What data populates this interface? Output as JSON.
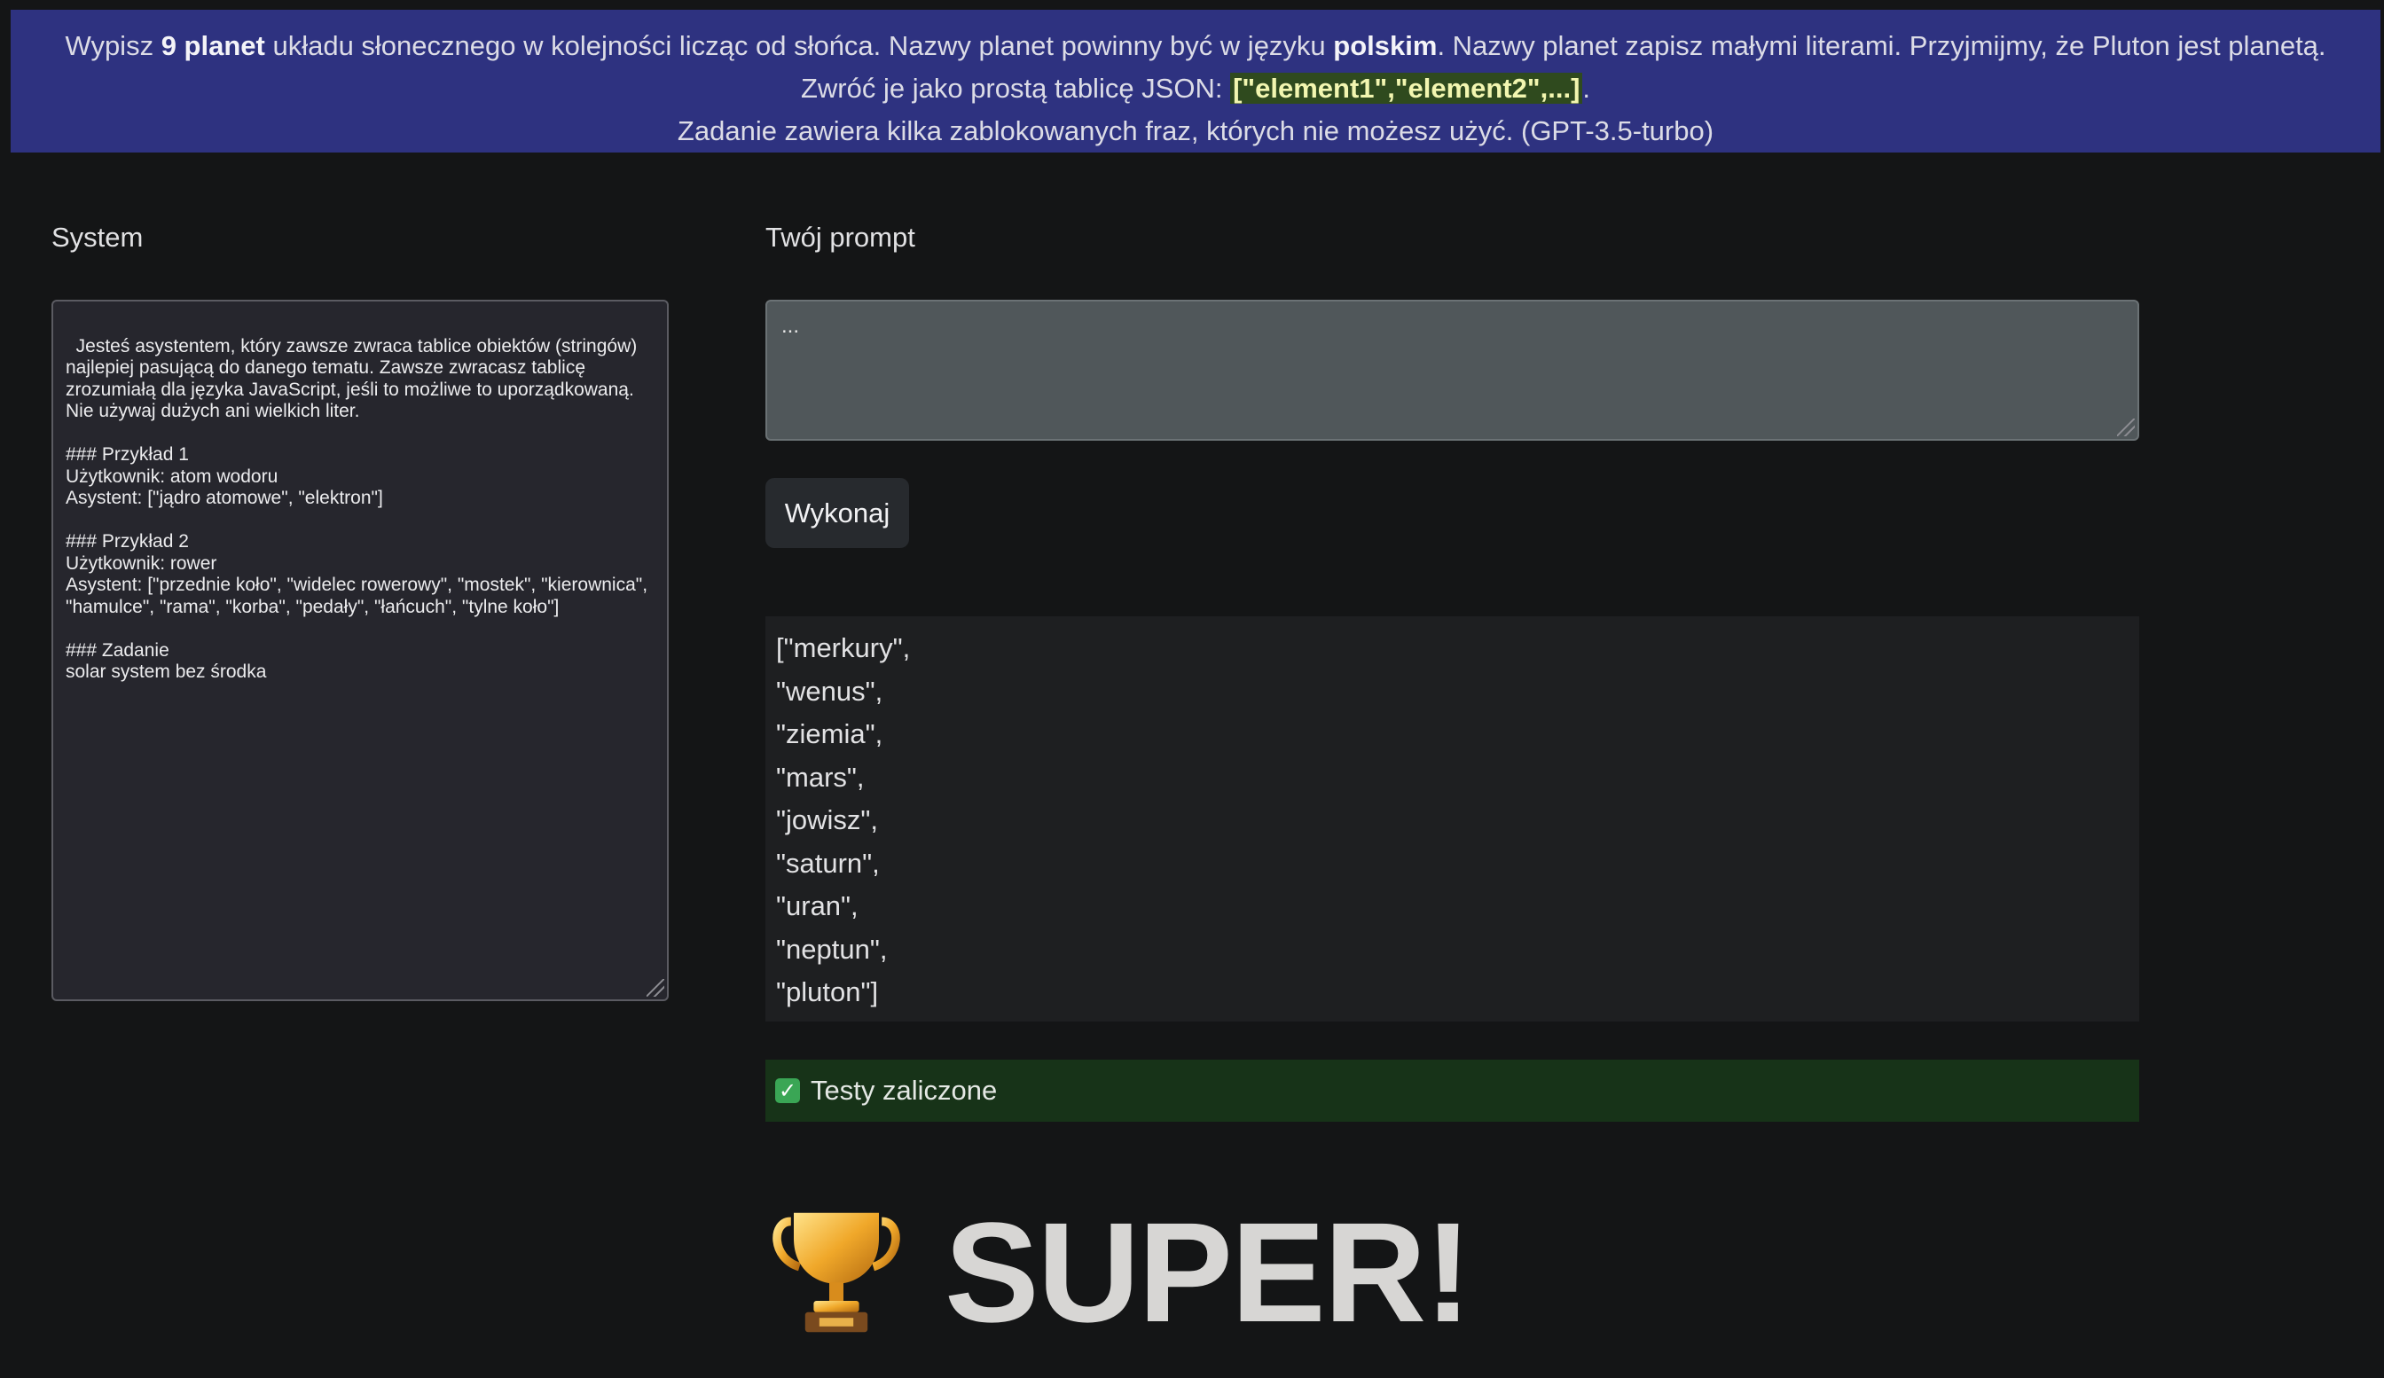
{
  "banner": {
    "line1_pre": "Wypisz ",
    "line1_bold1": "9 planet",
    "line1_mid": " układu słonecznego w kolejności licząc od słońca. Nazwy planet powinny być w języku ",
    "line1_bold2": "polskim",
    "line1_post": ". Nazwy planet zapisz małymi literami. Przyjmijmy, że Pluton jest planetą.",
    "line2_pre": "Zwróć je jako prostą tablicę JSON: ",
    "line2_code": "[\"element1\",\"element2\",...]",
    "line2_post": ".",
    "line3": "Zadanie zawiera kilka zablokowanych fraz, których nie możesz użyć. (GPT-3.5-turbo)"
  },
  "system": {
    "label": "System",
    "text": "Jesteś asystentem, który zawsze zwraca tablice obiektów (stringów)\nnajlepiej pasującą do danego tematu. Zawsze zwracasz tablicę\nzrozumiałą dla języka JavaScript, jeśli to możliwe to uporządkowaną.\nNie używaj dużych ani wielkich liter.\n\n### Przykład 1\nUżytkownik: atom wodoru\nAsystent: [\"jądro atomowe\", \"elektron\"]\n\n### Przykład 2\nUżytkownik: rower\nAsystent: [\"przednie koło\", \"widelec rowerowy\", \"mostek\", \"kierownica\",\n\"hamulce\", \"rama\", \"korba\", \"pedały\", \"łańcuch\", \"tylne koło\"]\n\n### Zadanie\nsolar system bez środka"
  },
  "prompt": {
    "label": "Twój prompt",
    "value": "..."
  },
  "run_button": "Wykonaj",
  "output": {
    "lines": [
      "[\"merkury\",",
      "\"wenus\",",
      "\"ziemia\",",
      "\"mars\",",
      "\"jowisz\",",
      "\"saturn\",",
      "\"uran\",",
      "\"neptun\",",
      "\"pluton\"]"
    ]
  },
  "test_status": {
    "text": "Testy zaliczone",
    "icon": "check-icon",
    "color": "#173318"
  },
  "success": {
    "text": "SUPER!",
    "icon": "trophy-icon"
  },
  "colors": {
    "banner_bg": "#2e3280",
    "page_bg": "#141516",
    "success_bg": "#173318"
  }
}
